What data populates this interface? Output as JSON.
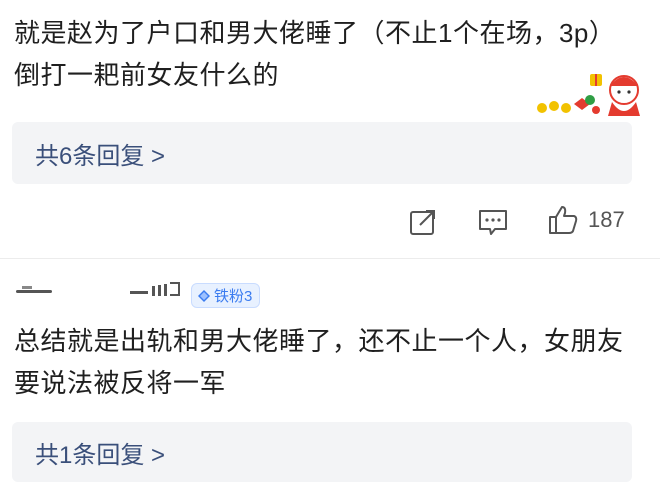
{
  "comment1": {
    "text": "就是赵为了户口和男大佬睡了（不止1个在场，3p）倒打一耙前女友什么的",
    "reply_link": "共6条回复 >",
    "like_count": "187"
  },
  "comment2": {
    "badge": "铁粉3",
    "text": "总结就是出轨和男大佬睡了，还不止一个人，女朋友要说法被反将一军",
    "reply_link": "共1条回复 >"
  }
}
